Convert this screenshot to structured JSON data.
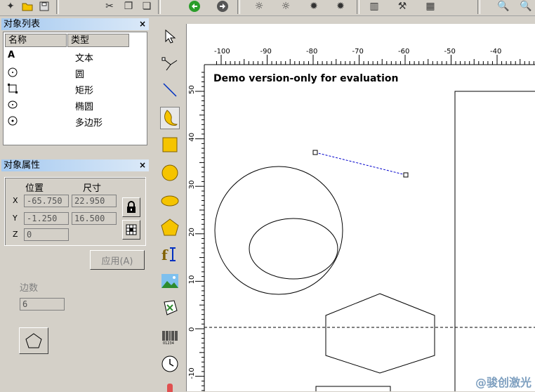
{
  "object_list": {
    "title": "对象列表",
    "close": "×",
    "columns": [
      "名称",
      "类型"
    ],
    "items": [
      {
        "icon": "text-icon",
        "glyph": "A",
        "type": "文本"
      },
      {
        "icon": "circle-icon",
        "type": "圆"
      },
      {
        "icon": "rectangle-icon",
        "type": "矩形"
      },
      {
        "icon": "ellipse-icon",
        "type": "椭圆"
      },
      {
        "icon": "polygon-icon",
        "type": "多边形"
      }
    ]
  },
  "object_properties": {
    "title": "对象属性",
    "close": "×",
    "position_label": "位置",
    "size_label": "尺寸",
    "x_label": "X",
    "y_label": "Y",
    "z_label": "Z",
    "x_value": "-65.750",
    "y_value": "-1.250",
    "z_value": "0",
    "width_value": "22.950",
    "height_value": "16.500",
    "apply_label": "应用(A)",
    "sides_label": "边数",
    "sides_value": "6"
  },
  "canvas": {
    "demo_text": "Demo version-only for evaluation",
    "ruler_top_labels": [
      "-100",
      "-90",
      "-80",
      "-70",
      "-60",
      "-50",
      "-40"
    ],
    "ruler_left_labels": [
      "50",
      "40",
      "30",
      "20",
      "10",
      "0",
      "-10"
    ]
  },
  "watermark": "@骏创激光",
  "colors": {
    "panel_title": "#a6caf0",
    "selection": "#0000cc",
    "tool_accent": "#f5c400"
  }
}
